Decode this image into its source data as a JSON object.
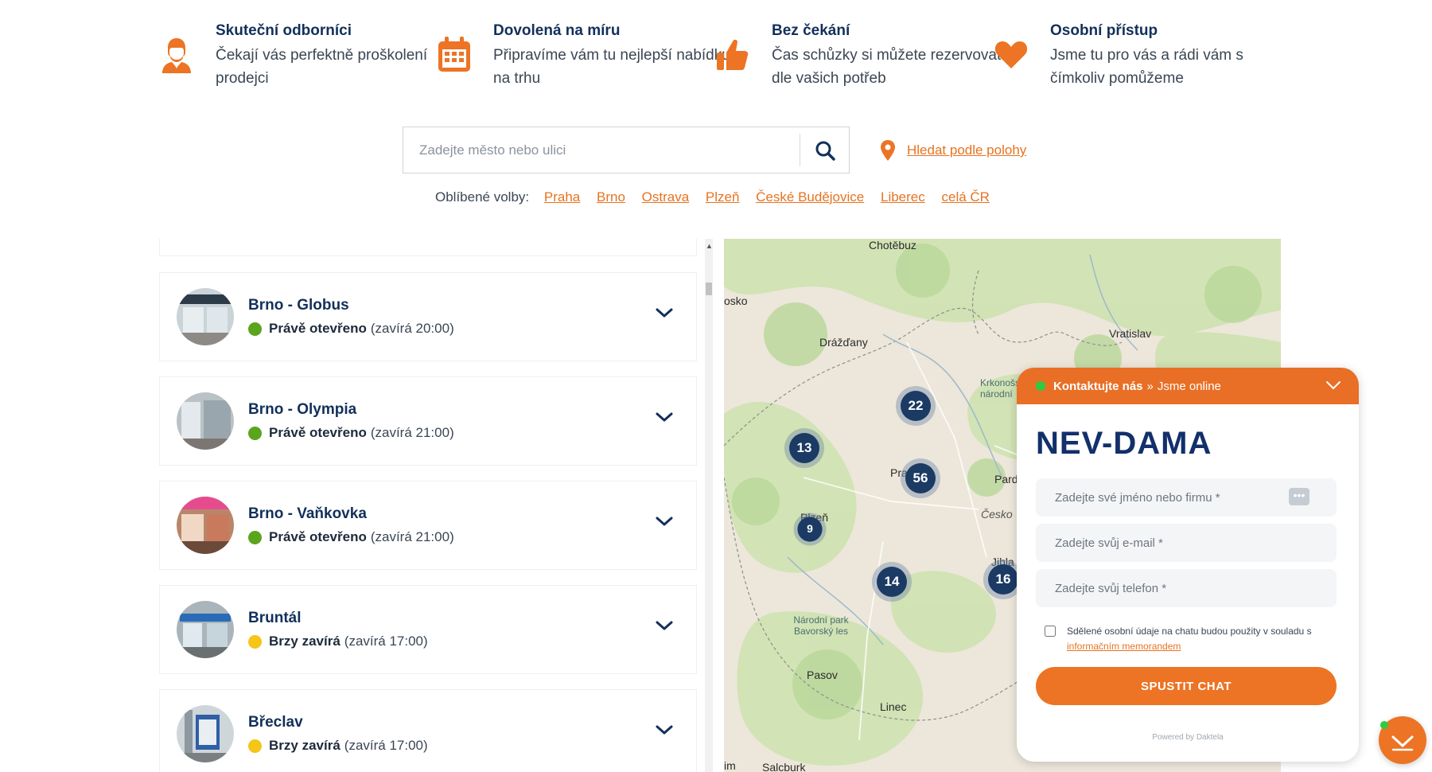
{
  "features": [
    {
      "icon": "advisor-icon",
      "title": "Skuteční odborníci",
      "desc": "Čekají vás perfektně proškolení prodejci"
    },
    {
      "icon": "calendar-icon",
      "title": "Dovolená na míru",
      "desc": "Připravíme vám tu nejlepší nabídku na trhu"
    },
    {
      "icon": "thumbs-up-icon",
      "title": "Bez čekání",
      "desc": "Čas schůzky si můžete rezervovat dle vašich potřeb"
    },
    {
      "icon": "heart-icon",
      "title": "Osobní přístup",
      "desc": "Jsme tu pro vás a rádi vám s čímkoliv pomůžeme"
    }
  ],
  "search": {
    "placeholder": "Zadejte město nebo ulici"
  },
  "geo_link": "Hledat podle polohy",
  "favorites": {
    "label": "Oblíbené volby:",
    "items": [
      "Praha",
      "Brno",
      "Ostrava",
      "Plzeň",
      "České Budějovice",
      "Liberec",
      "celá ČR"
    ]
  },
  "stores": [
    {
      "name": "Brno - Globus",
      "status": "Právě otevřeno",
      "hours": "(zavírá 20:00)",
      "status_color": "#5ba51e"
    },
    {
      "name": "Brno - Olympia",
      "status": "Právě otevřeno",
      "hours": "(zavírá 21:00)",
      "status_color": "#5ba51e"
    },
    {
      "name": "Brno - Vaňkovka",
      "status": "Právě otevřeno",
      "hours": "(zavírá 21:00)",
      "status_color": "#5ba51e"
    },
    {
      "name": "Bruntál",
      "status": "Brzy zavírá",
      "hours": "(zavírá 17:00)",
      "status_color": "#f5c518"
    },
    {
      "name": "Břeclav",
      "status": "Brzy zavírá",
      "hours": "(zavírá 17:00)",
      "status_color": "#f5c518"
    }
  ],
  "map": {
    "cities": [
      "Chotěbuz",
      "osko",
      "Drážďany",
      "Vratislav",
      "Krkonošský národní",
      "Pra",
      "Pard",
      "Plzeň",
      "Česko",
      "Jihla",
      "Národní park Bavorský les",
      "Pasov",
      "Linec",
      "Salcburk",
      "im"
    ],
    "clusters": [
      22,
      13,
      56,
      9,
      14,
      16
    ]
  },
  "chat": {
    "header_title": "Kontaktujte nás",
    "header_sep": "»",
    "header_status": "Jsme online",
    "logo": "NEV-DAMA",
    "name_placeholder": "Zadejte své jméno nebo firmu *",
    "email_placeholder": "Zadejte svůj e-mail *",
    "phone_placeholder": "Zadejte svůj telefon *",
    "consent_text": "Sdělené osobní údaje na chatu budou použity v souladu s",
    "consent_link": "informačním memorandem",
    "start_button": "SPUSTIT CHAT",
    "powered_by": "Powered by Daktela"
  },
  "colors": {
    "accent": "#ec7424",
    "navy": "#12305a",
    "open": "#5ba51e",
    "closing": "#f5c518"
  }
}
